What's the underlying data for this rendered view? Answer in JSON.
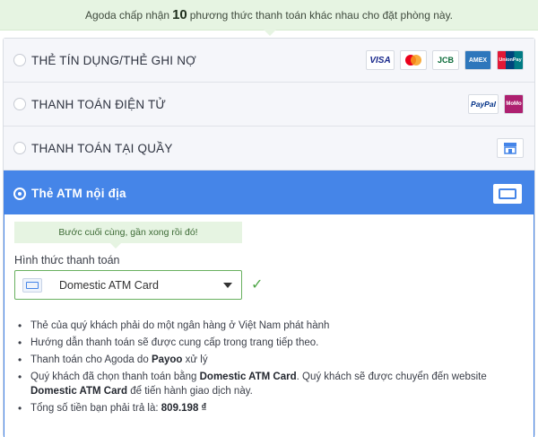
{
  "notice": {
    "prefix": "Agoda chấp nhận",
    "count": "10",
    "suffix": "phương thức thanh toán khác nhau cho đặt phòng này."
  },
  "methods": [
    {
      "label": "THẺ TÍN DỤNG/THẺ GHI NỢ",
      "logos": [
        "VISA",
        "mastercard-logo",
        "JCB",
        "AMEX",
        "UnionPay"
      ]
    },
    {
      "label": "THANH TOÁN ĐIỆN TỬ",
      "logos": [
        "PayPal",
        "MoMo"
      ]
    },
    {
      "label": "THANH TOÁN TẠI QUẦY",
      "logos": [
        "store-icon"
      ]
    },
    {
      "label": "Thẻ ATM nội địa",
      "selected": true,
      "logos": [
        "card-icon"
      ]
    }
  ],
  "panel": {
    "step_message": "Bước cuối cùng, gần xong rồi đó!",
    "field_label": "Hình thức thanh toán",
    "selected_option": "Domestic ATM Card",
    "bullets": {
      "b1": "Thẻ của quý khách phải do một ngân hàng ở Việt Nam phát hành",
      "b2": "Hướng dẫn thanh toán sẽ được cung cấp trong trang tiếp theo.",
      "b3_pre": "Thanh toán cho Agoda do",
      "b3_bold": "Payoo",
      "b3_post": "xử lý",
      "b4_pre": "Quý khách đã chọn thanh toán bằng",
      "b4_bold1": "Domestic ATM Card",
      "b4_mid": ". Quý khách sẽ được chuyển đến website",
      "b4_bold2": "Domestic ATM Card",
      "b4_post": "để tiến hành giao dịch này.",
      "b5_pre": "Tổng số tiền bạn phải trả là:",
      "b5_amount": "809.198 ₫"
    }
  },
  "colors": {
    "accent": "#4585e8",
    "success": "#4ea646",
    "notice_bg": "#e6f4e2"
  }
}
